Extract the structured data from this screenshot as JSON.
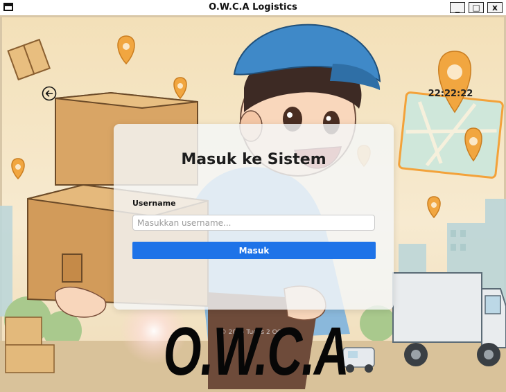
{
  "window": {
    "title": "O.W.C.A Logistics",
    "controls": {
      "minimize": "_",
      "maximize": "□",
      "close": "x"
    }
  },
  "icons": {
    "back": "back-arrow-circle-icon",
    "menu": "window-menu-icon"
  },
  "clock": "22:22:22",
  "login": {
    "title": "Masuk ke Sistem",
    "username_label": "Username",
    "username_value": "",
    "username_placeholder": "Masukkan username...",
    "submit_label": "Masuk"
  },
  "footer": "© 2025 Tugas 2 OOP",
  "brand": "O.W.C.A",
  "colors": {
    "accent": "#1e73e8",
    "panel": "#f4f6f8",
    "sky": "#f6e6c3"
  }
}
